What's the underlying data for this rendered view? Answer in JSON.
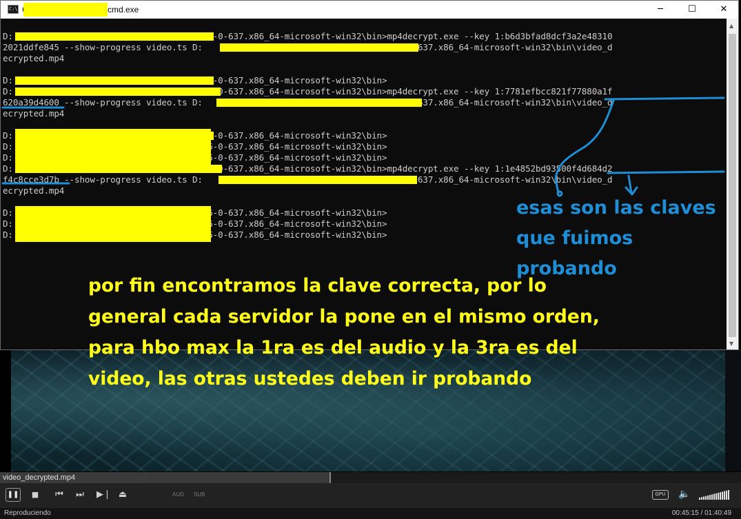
{
  "cmd_window": {
    "title_prefix": "C",
    "title": "cmd.exe",
    "minimize_glyph": "─",
    "maximize_glyph": "☐",
    "close_glyph": "✕",
    "app_icon_text": "C:\\"
  },
  "console_lines": [
    "D:                        \\Bento4-SDK-1-6-0-637.x86_64-microsoft-win32\\bin>mp4decrypt.exe --key 1:b6d3bfad8dcf3a2e48310",
    "2021ddfe845 --show-progress video.ts D:                        \\Bento4-SDK-1-6-0-637.x86_64-microsoft-win32\\bin\\video_d",
    "ecrypted.mp4",
    "",
    "D:                        \\Bento4-SDK-1-6-0-637.x86_64-microsoft-win32\\bin>",
    "D:                        \\Bento4-SDK-1-6-0-637.x86_64-microsoft-win32\\bin>mp4decrypt.exe --key 1:7781efbcc821f77880a1f",
    "620a39d4600 --show-progress video.ts D:                        \\Bento4-SDK-1-6-0-637.x86_64-microsoft-win32\\bin\\video_d",
    "ecrypted.mp4",
    "",
    "D:                        \\Bento4-SDK-1-6-0-637.x86_64-microsoft-win32\\bin>",
    "D:                        \\Bento4-SDK-1-6-0-637.x86_64-microsoft-win32\\bin>",
    "D:                        \\Bento4-SDK-1-6-0-637.x86_64-microsoft-win32\\bin>",
    "D:                        \\Bento4-SDK-1-6-0-637.x86_64-microsoft-win32\\bin>mp4decrypt.exe --key 1:1e4852bd93500f4d684d2",
    "f4c8cce3d7b --show-progress video.ts D:                        \\Bento4-SDK-1-6-0-637.x86_64-microsoft-win32\\bin\\video_d",
    "ecrypted.mp4",
    "",
    "D:                        \\Bento4-SDK-1-6-0-637.x86_64-microsoft-win32\\bin>",
    "D:                        \\Bento4-SDK-1-6-0-637.x86_64-microsoft-win32\\bin>",
    "D:                        \\Bento4-SDK-1-6-0-637.x86_64-microsoft-win32\\bin>"
  ],
  "annotations": {
    "keys_note": "esas son las claves\nque fuimos\nprobando",
    "main_note": "por fin encontramos la clave correcta, por lo general cada servidor la pone en el mismo orden, para hbo max la 1ra es del audio y la 3ra es del video, las otras ustedes deben ir probando",
    "keys_color": "#1e8fd6",
    "main_color": "#ffff1a",
    "redaction_color": "#ffff00"
  },
  "player": {
    "filename": "video_decrypted.mp4",
    "progress_fraction": 0.447,
    "play_pause_glyph": "❚❚",
    "stop_glyph": "■",
    "prev_glyph": "⏮",
    "next_glyph": "⏭",
    "frame_step_glyph": "▶❘",
    "eject_glyph": "⏏",
    "aud_label": "AUD",
    "sub_label": "SUB",
    "gpu_label": "GPU",
    "volume_glyph": "🔈",
    "status": "Reproduciendo",
    "time": "00:45:15 / 01:40:49",
    "volume_level": 1.0
  }
}
